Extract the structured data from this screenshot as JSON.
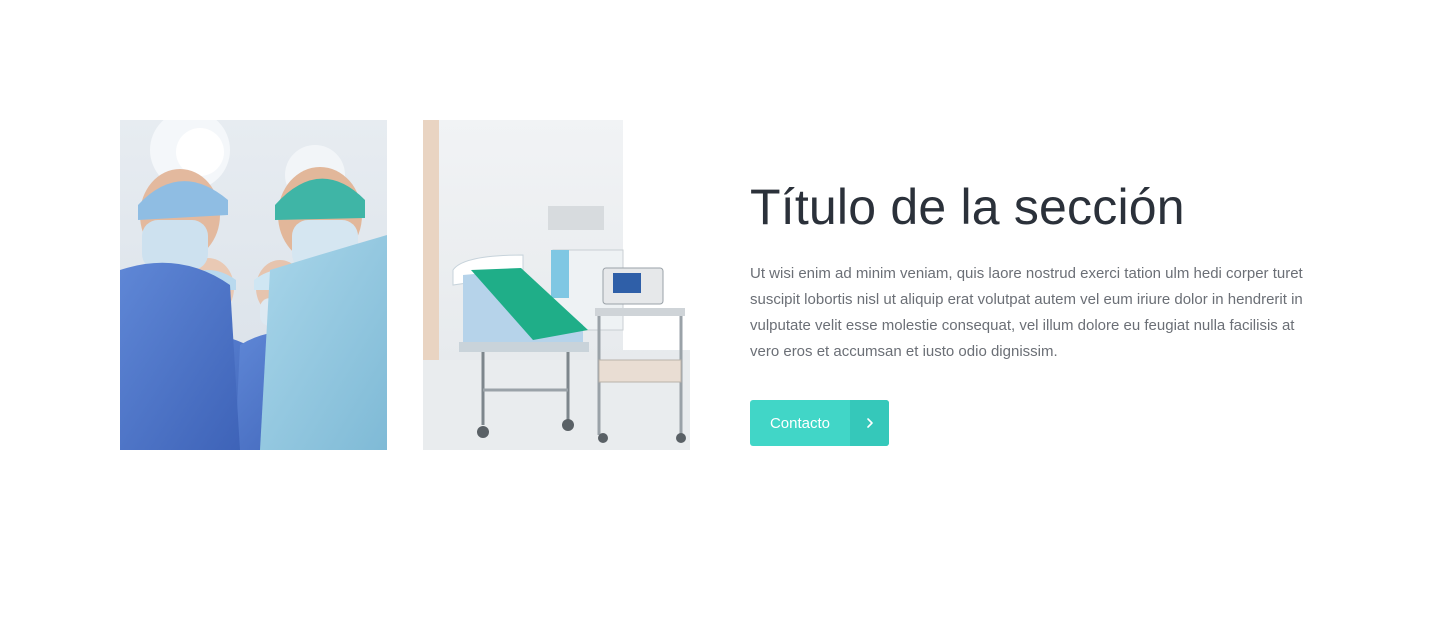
{
  "section": {
    "title": "Título de la sección",
    "body": "Ut wisi enim ad minim veniam, quis laore nostrud exerci tation ulm hedi corper turet suscipit lobortis nisl ut aliquip erat volutpat autem vel eum iriure dolor in hendrerit in vulputate velit esse molestie consequat, vel illum dolore eu feugiat nulla facilisis at vero eros et accumsan et iusto odio dignissim.",
    "button_label": "Contacto",
    "button_icon": "chevron-right-icon"
  },
  "images": {
    "first": "surgeons-photo",
    "second": "hospital-bed-photo"
  },
  "colors": {
    "accent": "#41d6c7",
    "accent_dark": "#35c8ba",
    "title": "#2b313a",
    "text": "#6b6f76"
  }
}
